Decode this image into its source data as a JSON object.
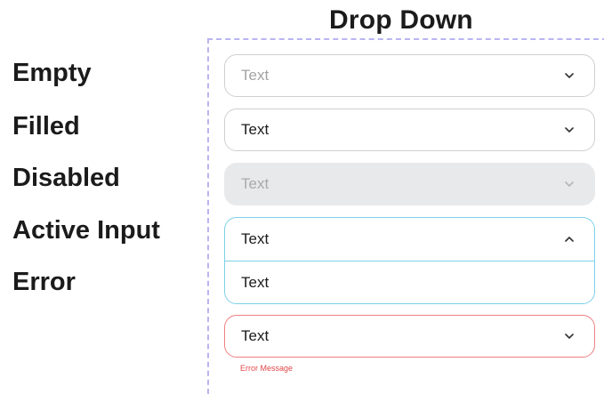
{
  "title": "Drop Down",
  "states": {
    "empty": "Empty",
    "filled": "Filled",
    "disabled": "Disabled",
    "active": "Active Input",
    "error": "Error"
  },
  "dropdowns": {
    "empty": {
      "value": "Text",
      "icon": "chevron-down-icon"
    },
    "filled": {
      "value": "Text",
      "icon": "chevron-down-icon"
    },
    "disabled": {
      "value": "Text",
      "icon": "chevron-down-icon"
    },
    "active": {
      "value": "Text",
      "icon": "chevron-up-icon",
      "options": [
        "Text"
      ]
    },
    "error": {
      "value": "Text",
      "icon": "chevron-down-icon",
      "message": "Error Message"
    }
  },
  "colors": {
    "frame": "#b9b4f1",
    "border_default": "#cfcfcf",
    "disabled_fill": "#e8e9eb",
    "active_border": "#7fd0e8",
    "error_border": "#f07f80",
    "error_text": "#e2484a"
  }
}
